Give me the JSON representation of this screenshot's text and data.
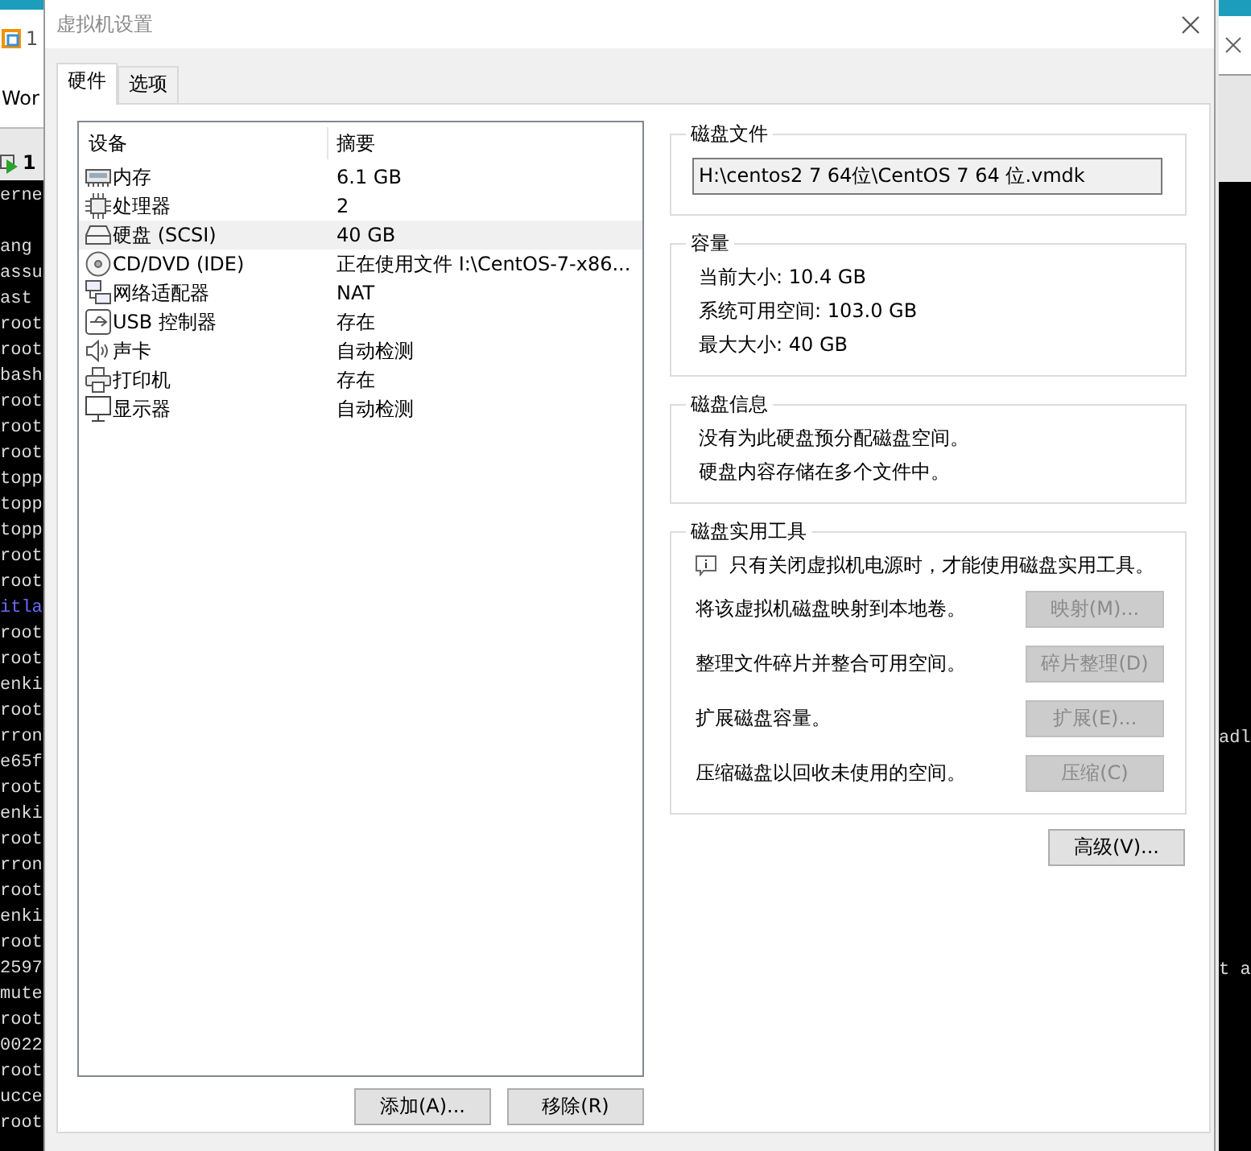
{
  "background_left": {
    "window_tab": "1",
    "menu_text": "Wor",
    "vm_tab": "1",
    "terminal_lines": [
      {
        "text": "erne"
      },
      {
        "kind": "blank"
      },
      {
        "text": "ang"
      },
      {
        "text": "assu"
      },
      {
        "text": "ast"
      },
      {
        "text": "root"
      },
      {
        "text": "root"
      },
      {
        "text": "bash"
      },
      {
        "text": "root"
      },
      {
        "text": "root"
      },
      {
        "text": "root"
      },
      {
        "text": "topp"
      },
      {
        "text": "topp"
      },
      {
        "text": "topp"
      },
      {
        "text": "root"
      },
      {
        "text": "root"
      },
      {
        "text": "itla",
        "color": "#6a6aff"
      },
      {
        "text": "root"
      },
      {
        "text": "root"
      },
      {
        "text": "enki"
      },
      {
        "text": "root"
      },
      {
        "text": "rron"
      },
      {
        "text": "e65f"
      },
      {
        "text": "root"
      },
      {
        "text": "enki"
      },
      {
        "text": "root"
      },
      {
        "text": "rron"
      },
      {
        "text": "root"
      },
      {
        "text": "enki"
      },
      {
        "text": "root"
      },
      {
        "text": "2597"
      },
      {
        "text": "mute"
      },
      {
        "text": "root"
      },
      {
        "text": "0022"
      },
      {
        "text": "root"
      },
      {
        "text": "ucce"
      },
      {
        "text": "root"
      }
    ]
  },
  "background_right": {
    "terminal_lines": [
      {
        "kind": "blank"
      },
      {
        "kind": "blank"
      },
      {
        "kind": "blank"
      },
      {
        "kind": "blank"
      },
      {
        "kind": "blank"
      },
      {
        "kind": "blank"
      },
      {
        "kind": "blank"
      },
      {
        "kind": "blank"
      },
      {
        "kind": "blank"
      },
      {
        "kind": "blank"
      },
      {
        "kind": "blank"
      },
      {
        "kind": "blank"
      },
      {
        "kind": "blank"
      },
      {
        "kind": "blank"
      },
      {
        "kind": "blank"
      },
      {
        "kind": "blank"
      },
      {
        "kind": "blank"
      },
      {
        "kind": "blank"
      },
      {
        "kind": "blank"
      },
      {
        "kind": "blank"
      },
      {
        "kind": "blank"
      },
      {
        "text": "adl"
      },
      {
        "kind": "blank"
      },
      {
        "kind": "blank"
      },
      {
        "kind": "blank"
      },
      {
        "kind": "blank"
      },
      {
        "kind": "blank"
      },
      {
        "kind": "blank"
      },
      {
        "kind": "blank"
      },
      {
        "kind": "blank"
      },
      {
        "text": "t a"
      }
    ]
  },
  "dialog": {
    "title": "虚拟机设置",
    "tabs": [
      {
        "label": "硬件",
        "selected": true
      },
      {
        "label": "选项",
        "selected": false
      }
    ],
    "device_table": {
      "columns": [
        "设备",
        "摘要"
      ],
      "rows": [
        {
          "kind": "memory",
          "device": "内存",
          "summary": "6.1 GB",
          "selected": false
        },
        {
          "kind": "processor",
          "device": "处理器",
          "summary": "2",
          "selected": false
        },
        {
          "kind": "disk",
          "device": "硬盘 (SCSI)",
          "summary": "40 GB",
          "selected": true
        },
        {
          "kind": "cd",
          "device": "CD/DVD (IDE)",
          "summary": "正在使用文件 I:\\CentOS-7-x86...",
          "selected": false
        },
        {
          "kind": "network",
          "device": "网络适配器",
          "summary": "NAT",
          "selected": false
        },
        {
          "kind": "usb",
          "device": "USB 控制器",
          "summary": "存在",
          "selected": false
        },
        {
          "kind": "sound",
          "device": "声卡",
          "summary": "自动检测",
          "selected": false
        },
        {
          "kind": "printer",
          "device": "打印机",
          "summary": "存在",
          "selected": false
        },
        {
          "kind": "display",
          "device": "显示器",
          "summary": "自动检测",
          "selected": false
        }
      ]
    },
    "list_buttons": [
      "添加(A)...",
      "移除(R)"
    ],
    "disk_file": {
      "title": "磁盘文件",
      "value": "H:\\centos2 7 64位\\CentOS 7 64 位.vmdk"
    },
    "capacity": {
      "title": "容量",
      "lines": [
        "当前大小: 10.4 GB",
        "系统可用空间: 103.0 GB",
        "最大大小: 40 GB"
      ]
    },
    "disk_info": {
      "title": "磁盘信息",
      "lines": [
        "没有为此硬盘预分配磁盘空间。",
        "硬盘内容存储在多个文件中。"
      ]
    },
    "utilities": {
      "title": "磁盘实用工具",
      "note": "只有关闭虚拟机电源时，才能使用磁盘实用工具。",
      "actions": [
        {
          "label": "将该虚拟机磁盘映射到本地卷。",
          "button": "映射(M)...",
          "disabled": true
        },
        {
          "label": "整理文件碎片并整合可用空间。",
          "button": "碎片整理(D)",
          "disabled": true
        },
        {
          "label": "扩展磁盘容量。",
          "button": "扩展(E)...",
          "disabled": true
        },
        {
          "label": "压缩磁盘以回收未使用的空间。",
          "button": "压缩(C)",
          "disabled": true
        }
      ]
    },
    "advanced_button": "高级(V)..."
  }
}
